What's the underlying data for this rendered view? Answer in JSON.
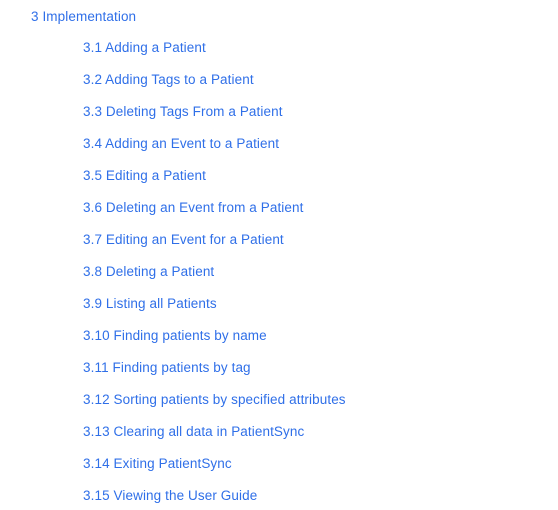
{
  "toc": {
    "section": {
      "label": "3 Implementation"
    },
    "items": [
      {
        "label": "3.1 Adding a Patient"
      },
      {
        "label": "3.2 Adding Tags to a Patient"
      },
      {
        "label": "3.3 Deleting Tags From a Patient"
      },
      {
        "label": "3.4 Adding an Event to a Patient"
      },
      {
        "label": "3.5 Editing a Patient"
      },
      {
        "label": "3.6 Deleting an Event from a Patient"
      },
      {
        "label": "3.7 Editing an Event for a Patient"
      },
      {
        "label": "3.8 Deleting a Patient"
      },
      {
        "label": "3.9 Listing all Patients"
      },
      {
        "label": "3.10 Finding patients by name"
      },
      {
        "label": "3.11 Finding patients by tag"
      },
      {
        "label": "3.12 Sorting patients by specified attributes"
      },
      {
        "label": "3.13 Clearing all data in PatientSync"
      },
      {
        "label": "3.14 Exiting PatientSync"
      },
      {
        "label": "3.15 Viewing the User Guide"
      }
    ]
  },
  "colors": {
    "link": "#2f6fe8",
    "background": "#ffffff"
  }
}
